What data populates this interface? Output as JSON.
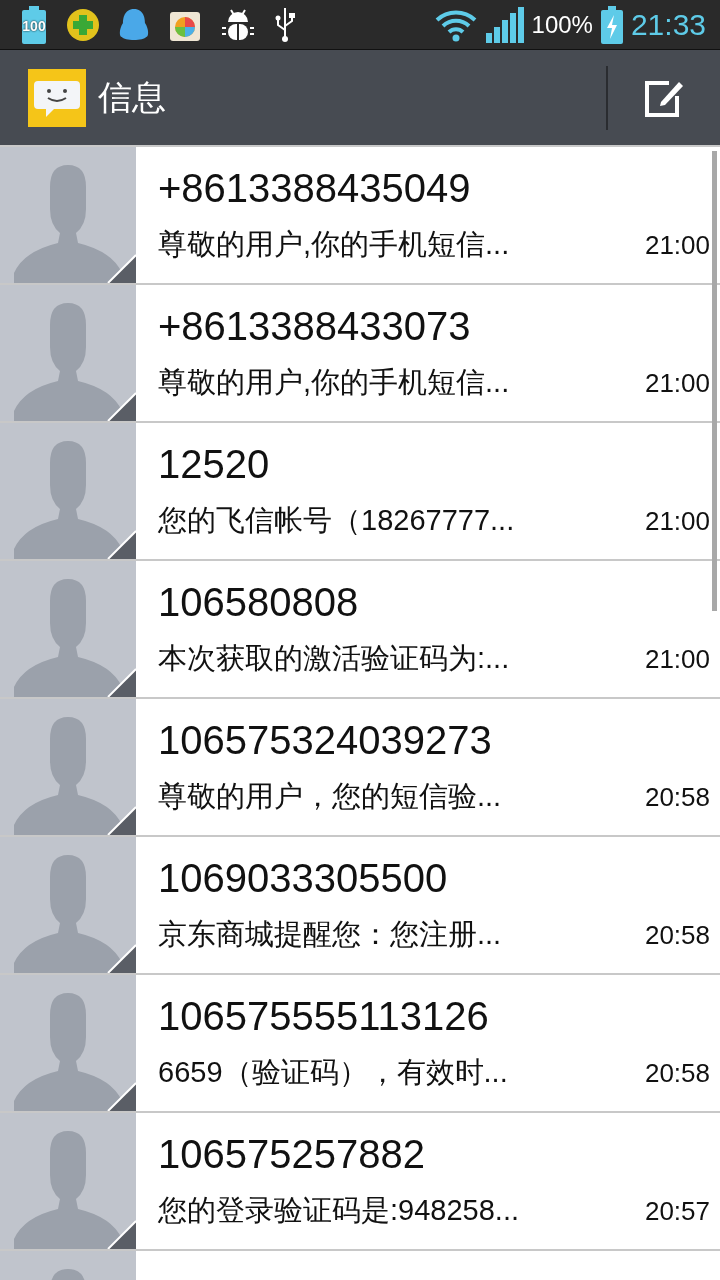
{
  "status_bar": {
    "battery_percent": "100%",
    "time": "21:33",
    "notification_badge": "100"
  },
  "header": {
    "title": "信息"
  },
  "conversations": [
    {
      "sender": "+8613388435049",
      "preview": "尊敬的用户,你的手机短信...",
      "time": "21:00"
    },
    {
      "sender": "+8613388433073",
      "preview": "尊敬的用户,你的手机短信...",
      "time": "21:00"
    },
    {
      "sender": "12520",
      "preview": "您的飞信帐号（18267777...",
      "time": "21:00"
    },
    {
      "sender": "106580808",
      "preview": "本次获取的激活验证码为:...",
      "time": "21:00"
    },
    {
      "sender": "106575324039273",
      "preview": "尊敬的用户，您的短信验...",
      "time": "20:58"
    },
    {
      "sender": "1069033305500",
      "preview": "京东商城提醒您：您注册...",
      "time": "20:58"
    },
    {
      "sender": "106575555113126",
      "preview": "6659（验证码），有效时...",
      "time": "20:58"
    },
    {
      "sender": "106575257882",
      "preview": "您的登录验证码是:948258...",
      "time": "20:57"
    }
  ]
}
